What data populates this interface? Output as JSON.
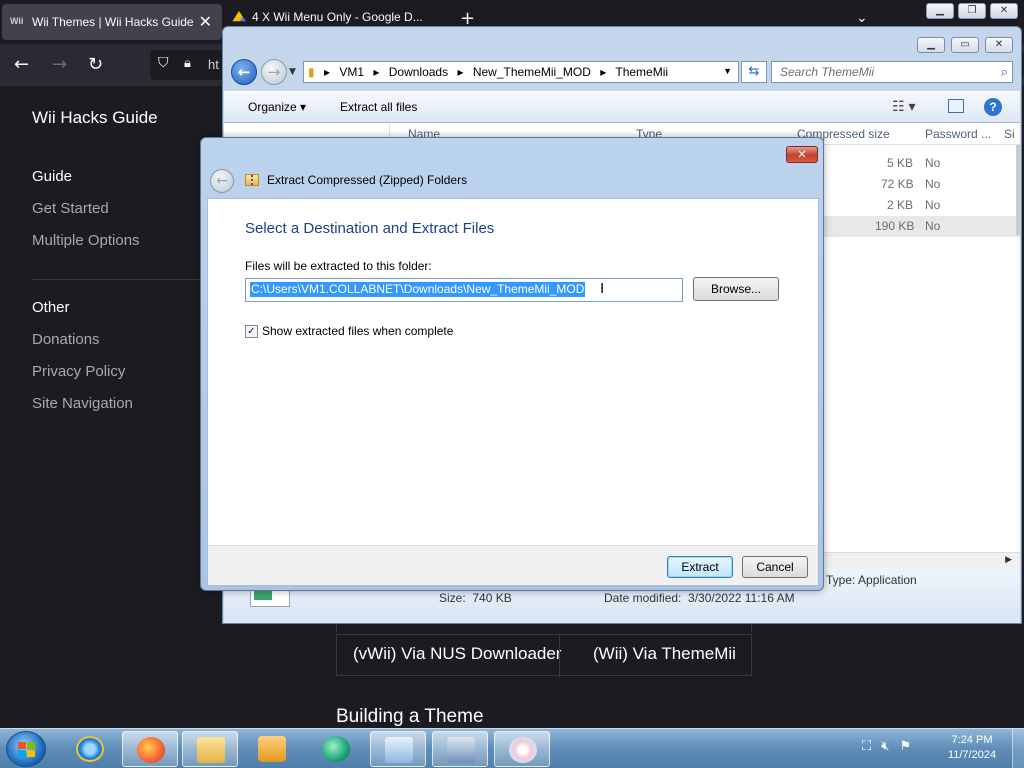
{
  "browser": {
    "active_tab": {
      "favicon": "Wii",
      "title": "Wii Themes | Wii Hacks Guide"
    },
    "tab2_title": "4 X Wii Menu Only - Google D...",
    "url_text": "ht",
    "sidebar": {
      "brand": "Wii Hacks Guide",
      "section1": "Guide",
      "items1": [
        "Get Started",
        "Multiple Options"
      ],
      "section2": "Other",
      "items2": [
        "Donations",
        "Privacy Policy",
        "Site Navigation"
      ]
    },
    "content": {
      "option1": "(vWii) Via NUS Downloader",
      "option2": "(Wii) Via ThemeMii",
      "heading": "Building a Theme"
    }
  },
  "explorer": {
    "breadcrumbs": [
      "VM1",
      "Downloads",
      "New_ThemeMii_MOD",
      "ThemeMii"
    ],
    "search_placeholder": "Search ThemeMii",
    "organize_label": "Organize",
    "extract_all_label": "Extract all files",
    "columns": [
      "Name",
      "Type",
      "Compressed size",
      "Password ...",
      "Si"
    ],
    "rows": [
      {
        "compressed_size": "5 KB",
        "password": "No"
      },
      {
        "compressed_size": "72 KB",
        "password": "No"
      },
      {
        "compressed_size": "2 KB",
        "password": "No"
      },
      {
        "compressed_size": "190 KB",
        "password": "No"
      }
    ],
    "details": {
      "type": "Type: Application",
      "size_label": "Size:",
      "size_value": "740 KB",
      "date_label": "Date modified:",
      "date_value": "3/30/2022 11:16 AM"
    }
  },
  "dialog": {
    "title": "Extract Compressed (Zipped) Folders",
    "heading": "Select a Destination and Extract Files",
    "path_label": "Files will be extracted to this folder:",
    "path_value": "C:\\Users\\VM1.COLLABNET\\Downloads\\New_ThemeMii_MOD",
    "browse_label": "Browse...",
    "show_files_label": "Show extracted files when complete",
    "show_files_checked": true,
    "extract_label": "Extract",
    "cancel_label": "Cancel"
  },
  "taskbar": {
    "time": "7:24 PM",
    "date": "11/7/2024"
  },
  "colors": {
    "dialog_heading": "#1e3f8a",
    "selection": "#3399ff",
    "browser_bg": "#1c1b22"
  }
}
